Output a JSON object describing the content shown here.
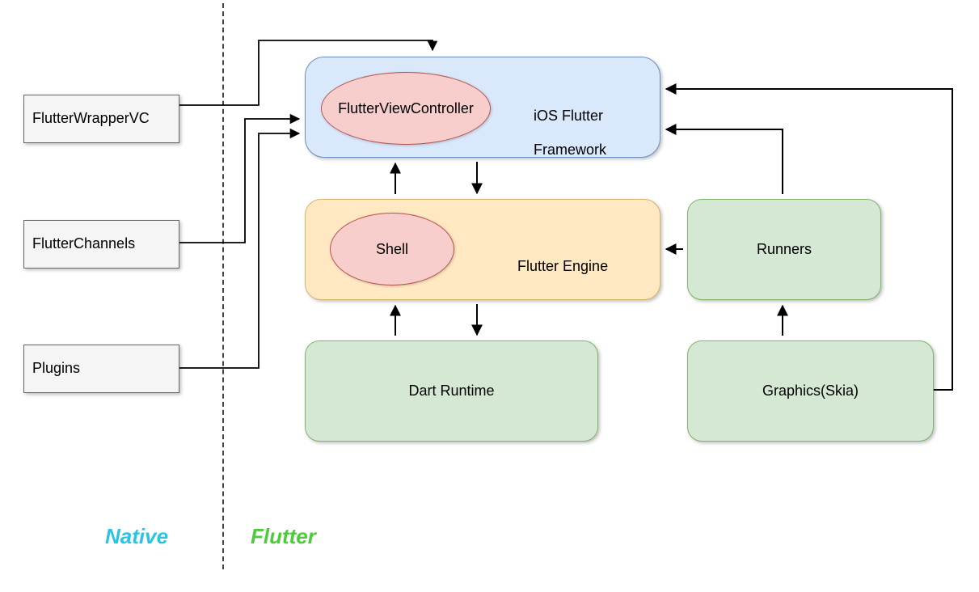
{
  "native": {
    "wrapper": "FlutterWrapperVC",
    "channels": "FlutterChannels",
    "plugins": "Plugins",
    "zone_label": "Native"
  },
  "flutter": {
    "zone_label": "Flutter",
    "framework": {
      "controller": "FlutterViewController",
      "label_line1": "iOS Flutter",
      "label_line2": "Framework"
    },
    "engine": {
      "shell": "Shell",
      "label": "Flutter Engine"
    },
    "dart_runtime": "Dart Runtime",
    "runners": "Runners",
    "graphics": "Graphics(Skia)"
  }
}
